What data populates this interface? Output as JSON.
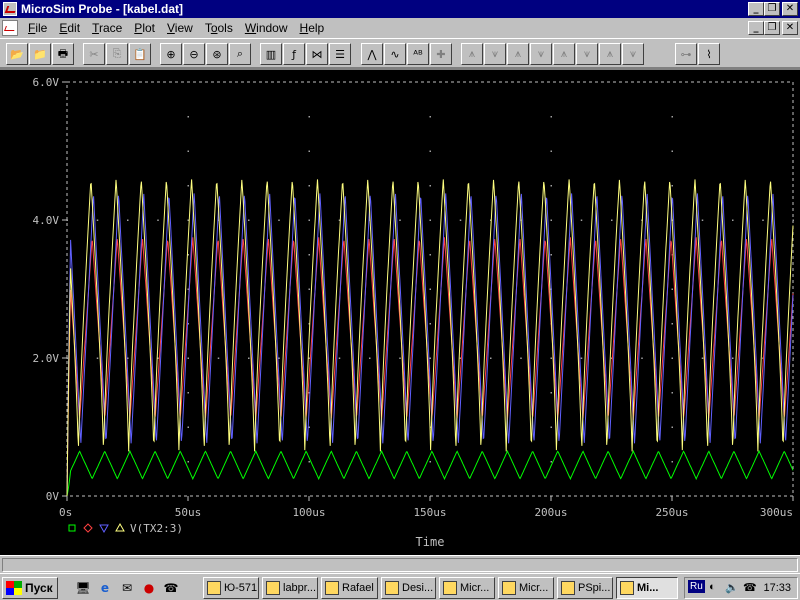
{
  "window": {
    "title": "MicroSim Probe - [kabel.dat]"
  },
  "menu": [
    {
      "label": "File",
      "key": "F"
    },
    {
      "label": "Edit",
      "key": "E"
    },
    {
      "label": "Trace",
      "key": "T"
    },
    {
      "label": "Plot",
      "key": "P"
    },
    {
      "label": "View",
      "key": "V"
    },
    {
      "label": "Tools",
      "key": "o"
    },
    {
      "label": "Window",
      "key": "W"
    },
    {
      "label": "Help",
      "key": "H"
    }
  ],
  "toolbar_icons": [
    "open-icon",
    "open-folder-icon",
    "print-icon",
    "cut-icon",
    "copy-icon",
    "paste-icon",
    "zoom-in-icon",
    "zoom-out-icon",
    "zoom-area-icon",
    "zoom-fit-icon",
    "log-x-icon",
    "fourier-icon",
    "performance-icon",
    "plot-window-icon",
    "add-trace-icon",
    "eval-goal-icon",
    "label-icon",
    "mark-icon",
    "cursor-peak-icon",
    "cursor-trough-icon",
    "cursor-slope-icon",
    "cursor-min-icon",
    "cursor-max-icon",
    "cursor-point-icon",
    "cursor-search-icon",
    "cursor-next-icon",
    "mark-label-icon",
    "display-control-icon"
  ],
  "chart_data": {
    "type": "line",
    "xlabel": "Time",
    "ylabel": "",
    "xlim": [
      0,
      300
    ],
    "ylim": [
      0,
      6
    ],
    "x_unit": "us",
    "xticks": [
      "0s",
      "50us",
      "100us",
      "150us",
      "200us",
      "250us",
      "300us"
    ],
    "yticks": [
      "0V",
      "2.0V",
      "4.0V",
      "6.0V"
    ],
    "grid": "dotted",
    "legend": "bottom-left",
    "legend_text": "V(TX2:3)",
    "period_us": 10.4,
    "series": [
      {
        "marker": "square",
        "color": "#00ff00",
        "min": 0.25,
        "max": 0.65
      },
      {
        "marker": "diamond",
        "color": "#ff4040",
        "min": 1.1,
        "max": 3.75
      },
      {
        "marker": "triangle-down",
        "color": "#6060ff",
        "min": 0.75,
        "max": 4.4
      },
      {
        "marker": "triangle-up",
        "color": "#ffff80",
        "min": 0.6,
        "max": 4.6
      }
    ]
  },
  "taskbar": {
    "start_label": "Пуск",
    "tasks": [
      "Ю-571",
      "labpr...",
      "Rafael",
      "Desi...",
      "Micr...",
      "Micr...",
      "PSpi...",
      "Mi..."
    ],
    "tray_lang": "Ru",
    "clock": "17:33"
  }
}
